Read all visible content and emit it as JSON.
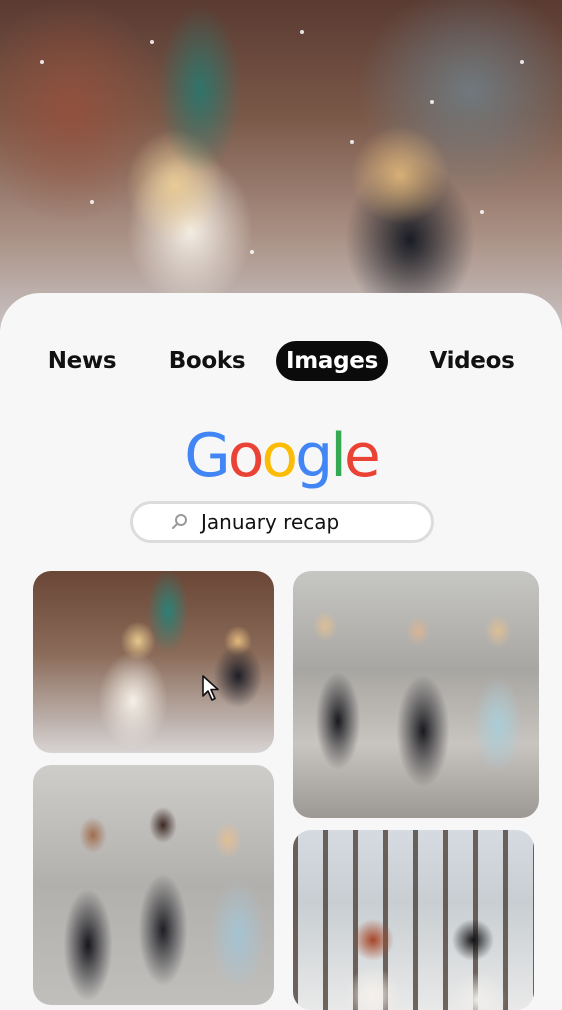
{
  "tabs": [
    {
      "label": "News",
      "active": false
    },
    {
      "label": "Books",
      "active": false
    },
    {
      "label": "Images",
      "active": true
    },
    {
      "label": "Videos",
      "active": false
    }
  ],
  "logo": {
    "letters": [
      "G",
      "o",
      "o",
      "g",
      "l",
      "e"
    ],
    "colors": [
      "#4285F4",
      "#EA4335",
      "#FBBC05",
      "#4285F4",
      "#34A853",
      "#EA4335"
    ]
  },
  "search": {
    "query": "January recap",
    "icon": "search-icon"
  },
  "results": [
    {
      "name": "result-image-1"
    },
    {
      "name": "result-image-2"
    },
    {
      "name": "result-image-3"
    },
    {
      "name": "result-image-4"
    }
  ]
}
